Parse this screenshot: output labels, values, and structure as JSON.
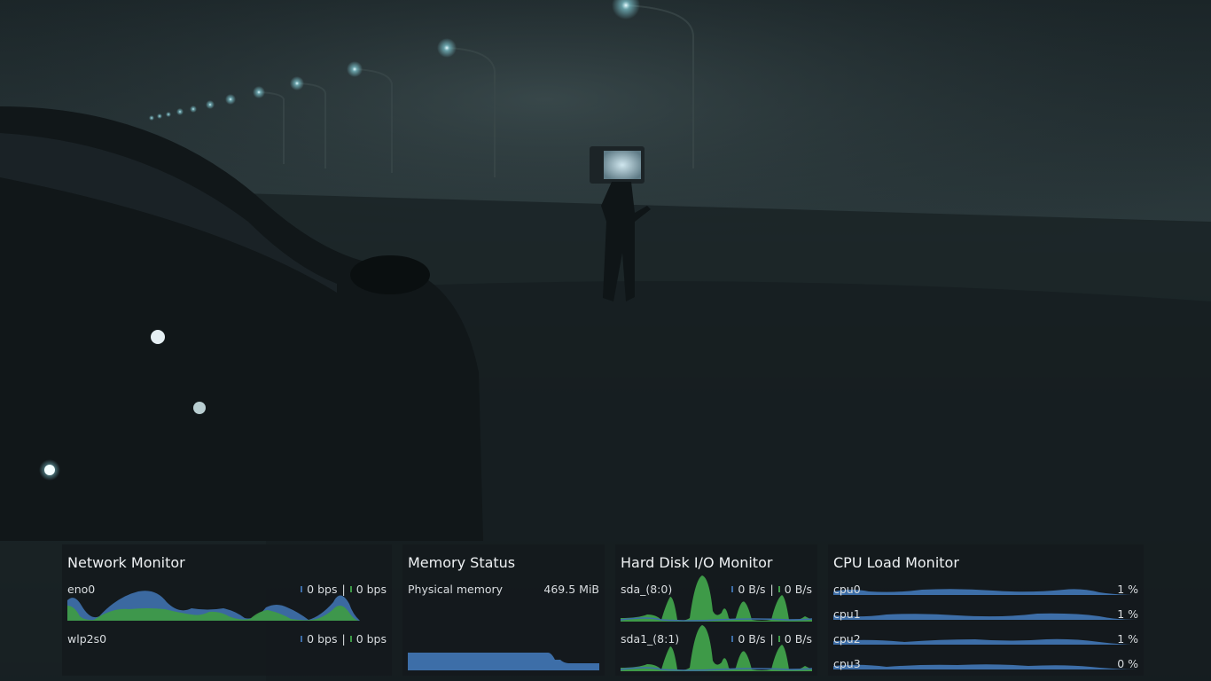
{
  "colors": {
    "series_blue": "#3d6ea8",
    "series_green": "#3e9a48",
    "panel_bg": "#14191d",
    "text": "#dfe3e6"
  },
  "network": {
    "title": "Network Monitor",
    "interfaces": [
      {
        "name": "eno0",
        "download": "0 bps",
        "upload": "0 bps"
      },
      {
        "name": "wlp2s0",
        "download": "0 bps",
        "upload": "0 bps"
      }
    ],
    "separator": "|"
  },
  "memory": {
    "title": "Memory Status",
    "label": "Physical memory",
    "value": "469.5 MiB"
  },
  "disk": {
    "title": "Hard Disk I/O Monitor",
    "devices": [
      {
        "name": "sda_(8:0)",
        "read": "0 B/s",
        "write": "0 B/s"
      },
      {
        "name": "sda1_(8:1)",
        "read": "0 B/s",
        "write": "0 B/s"
      }
    ],
    "separator": "|"
  },
  "cpu": {
    "title": "CPU Load Monitor",
    "cores": [
      {
        "name": "cpu0",
        "load": "1 %"
      },
      {
        "name": "cpu1",
        "load": "1 %"
      },
      {
        "name": "cpu2",
        "load": "1 %"
      },
      {
        "name": "cpu3",
        "load": "0 %"
      }
    ]
  }
}
